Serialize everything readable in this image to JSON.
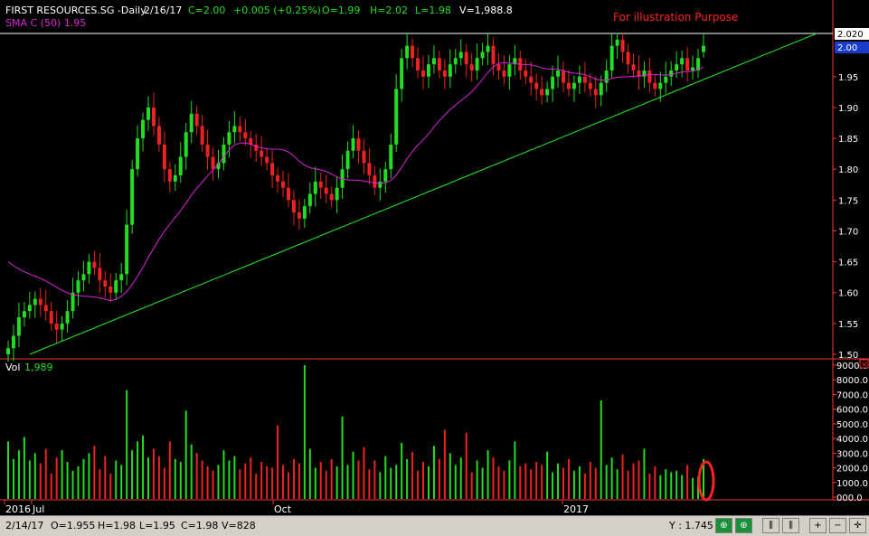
{
  "header": {
    "symbol": "FIRST RESOURCES.SG -Daily",
    "date": "2/16/17",
    "close": "C=2.00",
    "change": "+0.005 (+0.25%)",
    "open": "O=1.99",
    "high": "H=2.02",
    "low": "L=1.98",
    "volume": "V=1,988.8",
    "sma": "SMA C (50)  1.95",
    "illustration": "For illustration Purpose"
  },
  "volume_panel": {
    "label": "Vol",
    "value": "1,989"
  },
  "status_bar": {
    "date": "2/14/17",
    "open": "O=1.955",
    "high": "H=1.98",
    "low": "L=1.95",
    "close": "C=1.98",
    "volume": "V=828",
    "y_readout": "Y : 1.745"
  },
  "toolbar": [
    {
      "icon": "zoom-fit-icon"
    },
    {
      "icon": "zoom-reset-icon"
    },
    {
      "icon": "bar-chart-icon"
    },
    {
      "icon": "candlestick-icon"
    },
    {
      "icon": "zoom-in-icon"
    },
    {
      "icon": "zoom-out-icon"
    },
    {
      "icon": "crosshair-icon"
    }
  ],
  "colors": {
    "up": "#22dd22",
    "down": "#ee2222",
    "sma": "#dd22dd",
    "trend": "#22ee22",
    "axis": "#ff3333"
  },
  "chart_data": [
    {
      "type": "candlestick",
      "title": "FIRST RESOURCES.SG -Daily",
      "ylim": [
        1.5,
        2.02
      ],
      "yticks": [
        "1.50",
        "1.55",
        "1.60",
        "1.65",
        "1.70",
        "1.75",
        "1.80",
        "1.85",
        "1.90",
        "1.95",
        "2.00",
        "2.020"
      ],
      "price_labels": {
        "high_line": "2.020",
        "last": "2.00"
      },
      "xticks": [
        "2016",
        "Jul",
        "Oct",
        "2017"
      ],
      "closes": [
        1.51,
        1.53,
        1.56,
        1.57,
        1.58,
        1.59,
        1.58,
        1.57,
        1.55,
        1.54,
        1.55,
        1.57,
        1.6,
        1.62,
        1.63,
        1.65,
        1.64,
        1.62,
        1.61,
        1.6,
        1.62,
        1.63,
        1.71,
        1.8,
        1.85,
        1.88,
        1.9,
        1.87,
        1.84,
        1.8,
        1.78,
        1.79,
        1.82,
        1.86,
        1.89,
        1.87,
        1.84,
        1.82,
        1.8,
        1.81,
        1.84,
        1.86,
        1.87,
        1.86,
        1.85,
        1.84,
        1.83,
        1.82,
        1.81,
        1.79,
        1.78,
        1.77,
        1.75,
        1.73,
        1.72,
        1.74,
        1.76,
        1.78,
        1.77,
        1.76,
        1.75,
        1.77,
        1.8,
        1.83,
        1.85,
        1.83,
        1.81,
        1.79,
        1.77,
        1.78,
        1.8,
        1.84,
        1.93,
        1.98,
        2.0,
        1.98,
        1.96,
        1.95,
        1.97,
        1.98,
        1.96,
        1.95,
        1.97,
        1.98,
        1.99,
        1.97,
        1.96,
        1.98,
        1.99,
        2.0,
        1.97,
        1.96,
        1.95,
        1.97,
        1.98,
        1.96,
        1.95,
        1.94,
        1.93,
        1.92,
        1.93,
        1.95,
        1.96,
        1.94,
        1.93,
        1.94,
        1.95,
        1.94,
        1.93,
        1.92,
        1.94,
        1.96,
        2.0,
        2.01,
        1.99,
        1.97,
        1.96,
        1.95,
        1.96,
        1.94,
        1.93,
        1.94,
        1.95,
        1.96,
        1.97,
        1.98,
        1.96,
        1.96,
        1.98,
        2.0
      ],
      "sma": {
        "name": "SMA C (50)",
        "start": [
          0,
          1.65
        ],
        "end": [
          129,
          1.95
        ]
      },
      "trendline": {
        "from": [
          4,
          1.5
        ],
        "to": [
          150,
          2.02
        ]
      },
      "last_ohlc": {
        "open": 1.99,
        "high": 2.02,
        "low": 1.98,
        "close": 2.0
      }
    },
    {
      "type": "bar",
      "title": "Vol",
      "ylim": [
        0,
        9000
      ],
      "yticks": [
        "000.0",
        "1000.0",
        "2000.0",
        "3000.0",
        "4000.0",
        "5000.0",
        "6000.0",
        "7000.0",
        "8000.0",
        "9000.0"
      ],
      "values": [
        3800,
        2600,
        3200,
        4100,
        2500,
        3000,
        2300,
        3300,
        1600,
        2700,
        3200,
        2400,
        1800,
        2100,
        2600,
        3000,
        3500,
        1900,
        2800,
        1600,
        2500,
        2200,
        7300,
        3200,
        3800,
        4200,
        2700,
        3300,
        2800,
        2000,
        3800,
        2600,
        2400,
        5900,
        3600,
        3000,
        2500,
        2100,
        1800,
        2200,
        3200,
        2500,
        2800,
        1900,
        2300,
        2700,
        1600,
        2400,
        2100,
        2000,
        4900,
        2200,
        1700,
        2600,
        2300,
        9000,
        3300,
        2000,
        2400,
        1800,
        2600,
        2100,
        5500,
        2200,
        3100,
        2500,
        3400,
        1900,
        2500,
        1700,
        2800,
        2000,
        2200,
        3700,
        2600,
        3100,
        1800,
        2400,
        2100,
        3500,
        2600,
        4600,
        3000,
        2200,
        2700,
        4400,
        1700,
        2500,
        2000,
        3200,
        2700,
        2100,
        1800,
        2500,
        3800,
        2100,
        2300,
        1900,
        2400,
        2200,
        3100,
        1700,
        2300,
        2000,
        2600,
        1800,
        2100,
        1600,
        2400,
        2000,
        6600,
        2200,
        2700,
        1900,
        2900,
        1800,
        2300,
        2500,
        3300,
        1600,
        2100,
        1500,
        1900,
        1700,
        1800,
        1500,
        2200,
        1300,
        1400,
        2600
      ]
    }
  ]
}
